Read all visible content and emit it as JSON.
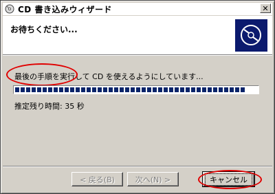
{
  "window": {
    "title": "CD 書き込みウィザード",
    "close_label": "✕"
  },
  "header": {
    "title": "お待ちください..."
  },
  "body": {
    "status": "最後の手順を実行して CD を使えるようにしています...",
    "remaining": "推定残り時間: 35 秒",
    "progress_fraction": 0.95
  },
  "buttons": {
    "back": "< 戻る(B)",
    "next": "次へ(N) >",
    "cancel": "キャンセル"
  },
  "colors": {
    "accent": "#0a246a",
    "annotation": "#e00000",
    "face": "#d4d0c8"
  }
}
